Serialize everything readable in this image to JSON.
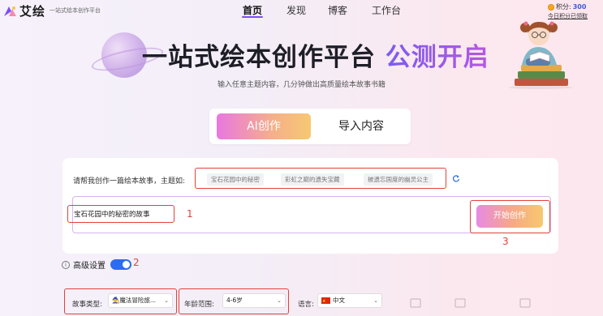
{
  "header": {
    "logo_text": "艾绘",
    "logo_subtitle": "一站式绘本创作平台",
    "nav": [
      "首页",
      "发现",
      "博客",
      "工作台"
    ],
    "points_label": "积分:",
    "points_value": "300",
    "checkin_text": "今日积分已领取"
  },
  "hero": {
    "title_main": "一站式绘本创作平台",
    "title_highlight": "公测开启",
    "subtitle": "输入任意主题内容，几分钟做出高质量绘本故事书籍"
  },
  "modes": {
    "ai": "AI创作",
    "import": "导入内容"
  },
  "prompt": {
    "label": "请帮我创作一篇绘本故事，主题如:",
    "suggestions": [
      "宝石花园中的秘密",
      "彩虹之巅的遗失宝藏",
      "被遗忘国度的幽灵公主"
    ],
    "input_value": "宝石花园中的秘密的故事",
    "start_button": "开始创作"
  },
  "annotations": [
    "1",
    "2",
    "3"
  ],
  "advanced": {
    "label": "高级设置",
    "enabled": true
  },
  "options": {
    "story_type_label": "故事类型:",
    "story_type_value": "🧙魔法冒险旅...",
    "age_label": "年龄范围:",
    "age_value": "4-6岁",
    "language_label": "语言:",
    "language_value": "中文"
  },
  "colors": {
    "accent": "#7c4dff",
    "annotation_red": "#e0433a",
    "toggle_blue": "#2f6bed"
  }
}
